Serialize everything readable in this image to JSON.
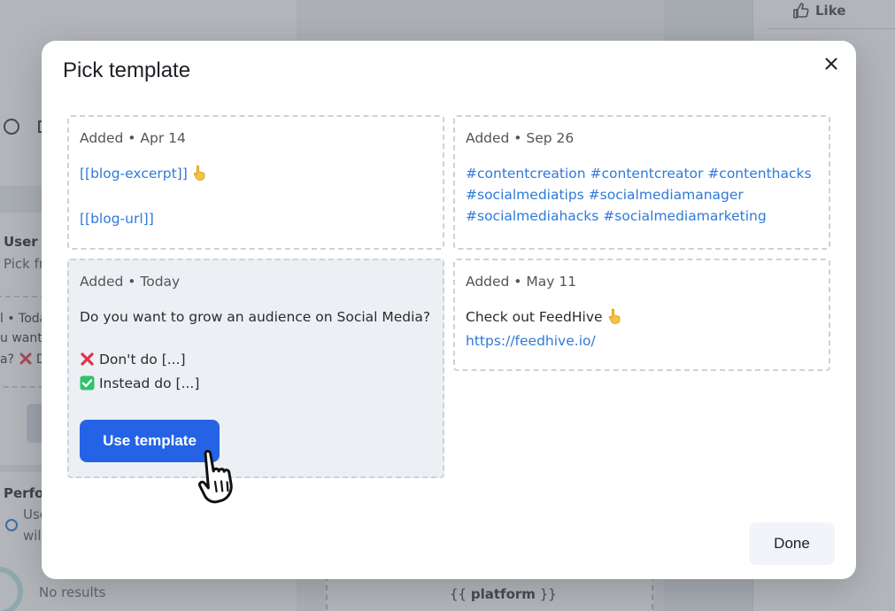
{
  "background": {
    "like_label": "Like",
    "user_title": "User t",
    "user_sub": "Pick fr",
    "snippet_lines": [
      "l • Today",
      "u want",
      "a?"
    ],
    "snippet_d": "D",
    "performance_title": "Perfo",
    "performance_line1": "Use",
    "performance_line2": "wil",
    "no_results": "No results",
    "platform_open": "{{",
    "platform_word": "platform",
    "platform_close": "}}"
  },
  "modal": {
    "title": "Pick template",
    "close_icon": "close-icon",
    "done_label": "Done",
    "use_template_label": "Use template",
    "cards": [
      {
        "meta": "Added • Apr 14",
        "lines": [
          "[[blog-excerpt]]",
          "[[blog-url]]"
        ],
        "emoji": "👇"
      },
      {
        "meta": "Added • Sep 26",
        "lines": [
          "#contentcreation #contentcreator #contenthacks",
          "#socialmediatips #socialmediamanager",
          "#socialmediahacks #socialmediamarketing"
        ]
      },
      {
        "meta": "Added • Today",
        "question": "Do you want to grow an audience on Social Media?",
        "dont": "Don't do [...]",
        "instead": "Instead do [...]"
      },
      {
        "meta": "Added • May 11",
        "text": "Check out FeedHive",
        "emoji": "👇",
        "url": "https://feedhive.io/"
      }
    ]
  },
  "colors": {
    "accent": "#2563e6",
    "link": "#2f7ad8",
    "dashed_border": "#ccd2dc",
    "active_card_bg": "#ecf0f5",
    "overlay": "#5f646e"
  }
}
